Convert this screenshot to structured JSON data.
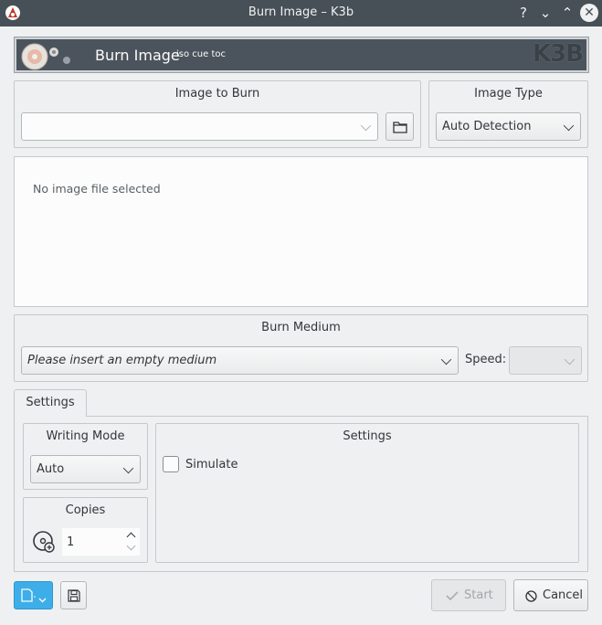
{
  "window": {
    "title": "Burn Image – K3b",
    "help_glyph": "?",
    "minimize_glyph": "⌄",
    "maximize_glyph": "⌃",
    "close_glyph": "✕"
  },
  "header": {
    "title": "Burn Image",
    "subtitle": "iso cue toc",
    "logo_text": "K3B"
  },
  "image_to_burn": {
    "title": "Image to Burn",
    "path_value": ""
  },
  "image_type": {
    "title": "Image Type",
    "selected": "Auto Detection"
  },
  "info": {
    "message": "No image file selected"
  },
  "burn_medium": {
    "title": "Burn Medium",
    "selected": "Please insert an empty medium",
    "speed_label": "Speed:",
    "speed_value": ""
  },
  "tabs": [
    {
      "label": "Settings"
    }
  ],
  "writing_mode": {
    "title": "Writing Mode",
    "selected": "Auto"
  },
  "copies": {
    "title": "Copies",
    "value": "1"
  },
  "settings_group": {
    "title": "Settings",
    "simulate_label": "Simulate",
    "simulate_checked": false
  },
  "footer": {
    "start_label": "Start",
    "cancel_label": "Cancel"
  },
  "colors": {
    "titlebar": "#475057",
    "accent": "#3daee9",
    "window_bg": "#eff0f1"
  }
}
